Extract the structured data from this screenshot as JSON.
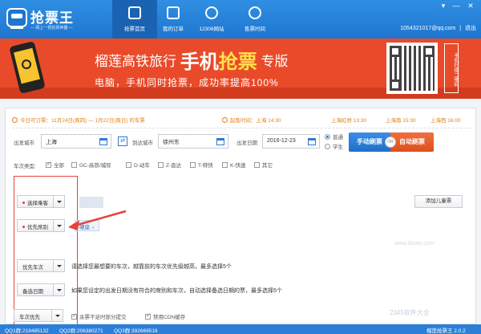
{
  "app": {
    "title": "抢票王",
    "subtitle": "— 网上一把抢票神器 —"
  },
  "nav": {
    "tabs": [
      {
        "label": "抢票首页",
        "icon": "train-icon",
        "active": true
      },
      {
        "label": "我的订单",
        "icon": "order-check-icon",
        "active": false
      },
      {
        "label": "12306网站",
        "icon": "web-globe-icon",
        "active": false
      },
      {
        "label": "售票时间",
        "icon": "clock-icon",
        "active": false
      }
    ]
  },
  "window_controls": {
    "skin": "▾",
    "minimize": "—",
    "close": "✕"
  },
  "user": {
    "account": "1054321017@qq.com",
    "separator": "|",
    "logout": "退出"
  },
  "banner": {
    "title_pre": "榴莲高铁旅行",
    "title_big": "手机",
    "title_big2": "抢票",
    "title_post": "专版",
    "subtitle": "电脑，手机同时抢票，成功率提高100%",
    "qr_note": "手机扫描二维码"
  },
  "info": {
    "presale": "今日可订票：11月24日(周四) — 1月22日(周日) 的车票",
    "times": [
      {
        "text": "起售时间：上海 14:30",
        "strong": true
      },
      {
        "text": "上海虹桥 13:30"
      },
      {
        "text": "上海南 15:30"
      },
      {
        "text": "上海西 16:00"
      }
    ]
  },
  "search": {
    "from_label": "出发城市",
    "from_value": "上海",
    "swap_icon": "⇄",
    "to_label": "到达城市",
    "to_value": "徐州东",
    "date_label": "出发日期",
    "date_value": "2016-12-23",
    "ticket_types": [
      {
        "label": "普通",
        "selected": true
      },
      {
        "label": "学生",
        "selected": false
      }
    ],
    "manual_btn": "手动刷票",
    "or": "OR",
    "auto_btn": "自动刷票"
  },
  "train_types": {
    "label": "车次类型:",
    "options": [
      {
        "label": "全部",
        "checked": true
      },
      {
        "label": "GC-高铁/城际",
        "checked": false
      },
      {
        "label": "D-动车",
        "checked": false
      },
      {
        "label": "Z-直达",
        "checked": false
      },
      {
        "label": "T-特快",
        "checked": false
      },
      {
        "label": "K-快速",
        "checked": false
      },
      {
        "label": "其它",
        "checked": false
      }
    ]
  },
  "passengers": {
    "select_label": "选择乘客",
    "add_child": "添加儿童票"
  },
  "seats": {
    "priority_label": "优先席别",
    "chip": "硬座",
    "chip_remove": "x"
  },
  "trains": {
    "priority_label": "优先车次",
    "hint": "请选择您最想要的车次，越靠前的车次优先级越高，最多选择5个"
  },
  "backup_dates": {
    "label": "备选日期",
    "hint": "如果您设定的出发日期没有符合的席别和车次，自动选择备选日期的票，最多选择5个"
  },
  "options": {
    "priority_label": "车次优先",
    "partial_submit": "余票不足时部分提交",
    "disable_cdn": "禁用CDN缓存"
  },
  "status": {
    "qq1": "QQ1群:218485132",
    "qq2": "QQ2群:206380271",
    "qq3": "QQ3群:392669516",
    "version": "榴莲抢票王 2.0.2"
  },
  "watermarks": {
    "main": "2345软件大全",
    "url": "www.duote.com"
  }
}
